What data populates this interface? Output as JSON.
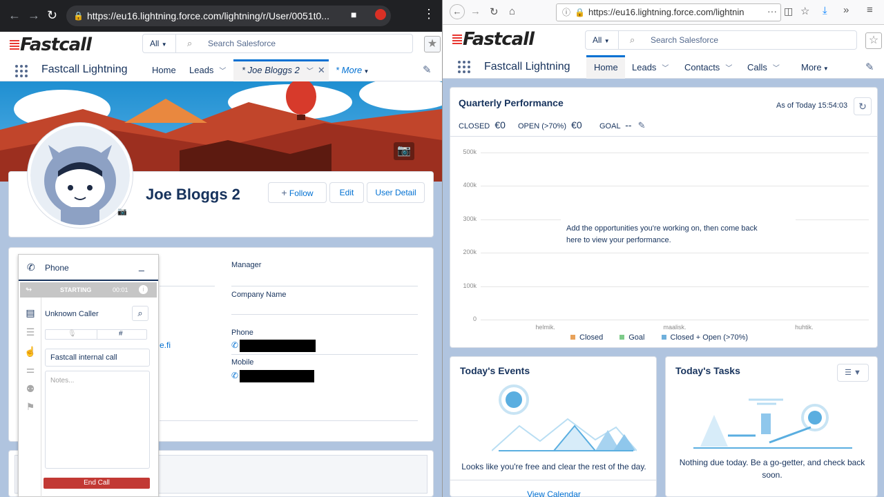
{
  "left": {
    "browser": {
      "url": "https://eu16.lightning.force.com/lightning/r/User/0051t0..."
    },
    "brand": {
      "logo_text": "Fastcall"
    },
    "search": {
      "scope": "All",
      "placeholder": "Search Salesforce"
    },
    "app_name": "Fastcall Lightning",
    "nav": {
      "home": "Home",
      "leads": "Leads",
      "tab_active": "* Joe Bloggs 2",
      "more": "* More"
    },
    "profile": {
      "name": "Joe Bloggs 2",
      "follow": "Follow",
      "edit": "Edit",
      "user_detail": "User Detail"
    },
    "fields": {
      "manager": "Manager",
      "company": "Company Name",
      "phone": "Phone",
      "mobile": "Mobile",
      "email_fragment": "e.fi"
    },
    "phone_panel": {
      "title": "Phone",
      "status": "STARTING",
      "timer": "00:01",
      "caller": "Unknown Caller",
      "call_subject": "Fastcall internal call",
      "notes_placeholder": "Notes...",
      "end_call": "End Call"
    }
  },
  "right": {
    "browser": {
      "url": "https://eu16.lightning.force.com/lightnin"
    },
    "brand": {
      "logo_text": "Fastcall"
    },
    "search": {
      "scope": "All",
      "placeholder": "Search Salesforce"
    },
    "app_name": "Fastcall Lightning",
    "nav": {
      "home": "Home",
      "leads": "Leads",
      "contacts": "Contacts",
      "calls": "Calls",
      "more": "More"
    },
    "performance": {
      "title": "Quarterly Performance",
      "as_of": "As of Today 15:54:03",
      "closed_label": "CLOSED",
      "closed_value": "€0",
      "open_label": "OPEN (>70%)",
      "open_value": "€0",
      "goal_label": "GOAL",
      "goal_value": "--",
      "empty_message_1": "Add the opportunities you're working on, then come back",
      "empty_message_2": "here to view your performance."
    },
    "chart_data": {
      "type": "line",
      "categories": [
        "helmik.",
        "maalisk.",
        "huhtik."
      ],
      "y_ticks": [
        "500k",
        "400k",
        "300k",
        "200k",
        "100k",
        "0"
      ],
      "ylim": [
        0,
        500000
      ],
      "series": [
        {
          "name": "Closed",
          "color": "#e8a25a",
          "values": []
        },
        {
          "name": "Goal",
          "color": "#7ecb8a",
          "values": []
        },
        {
          "name": "Closed + Open (>70%)",
          "color": "#6fb0dc",
          "values": []
        }
      ]
    },
    "events": {
      "title": "Today's Events",
      "message": "Looks like you're free and clear the rest of the day.",
      "link": "View Calendar"
    },
    "tasks": {
      "title": "Today's Tasks",
      "message_1": "Nothing due today. Be a go-getter, and check back",
      "message_2": "soon."
    }
  }
}
